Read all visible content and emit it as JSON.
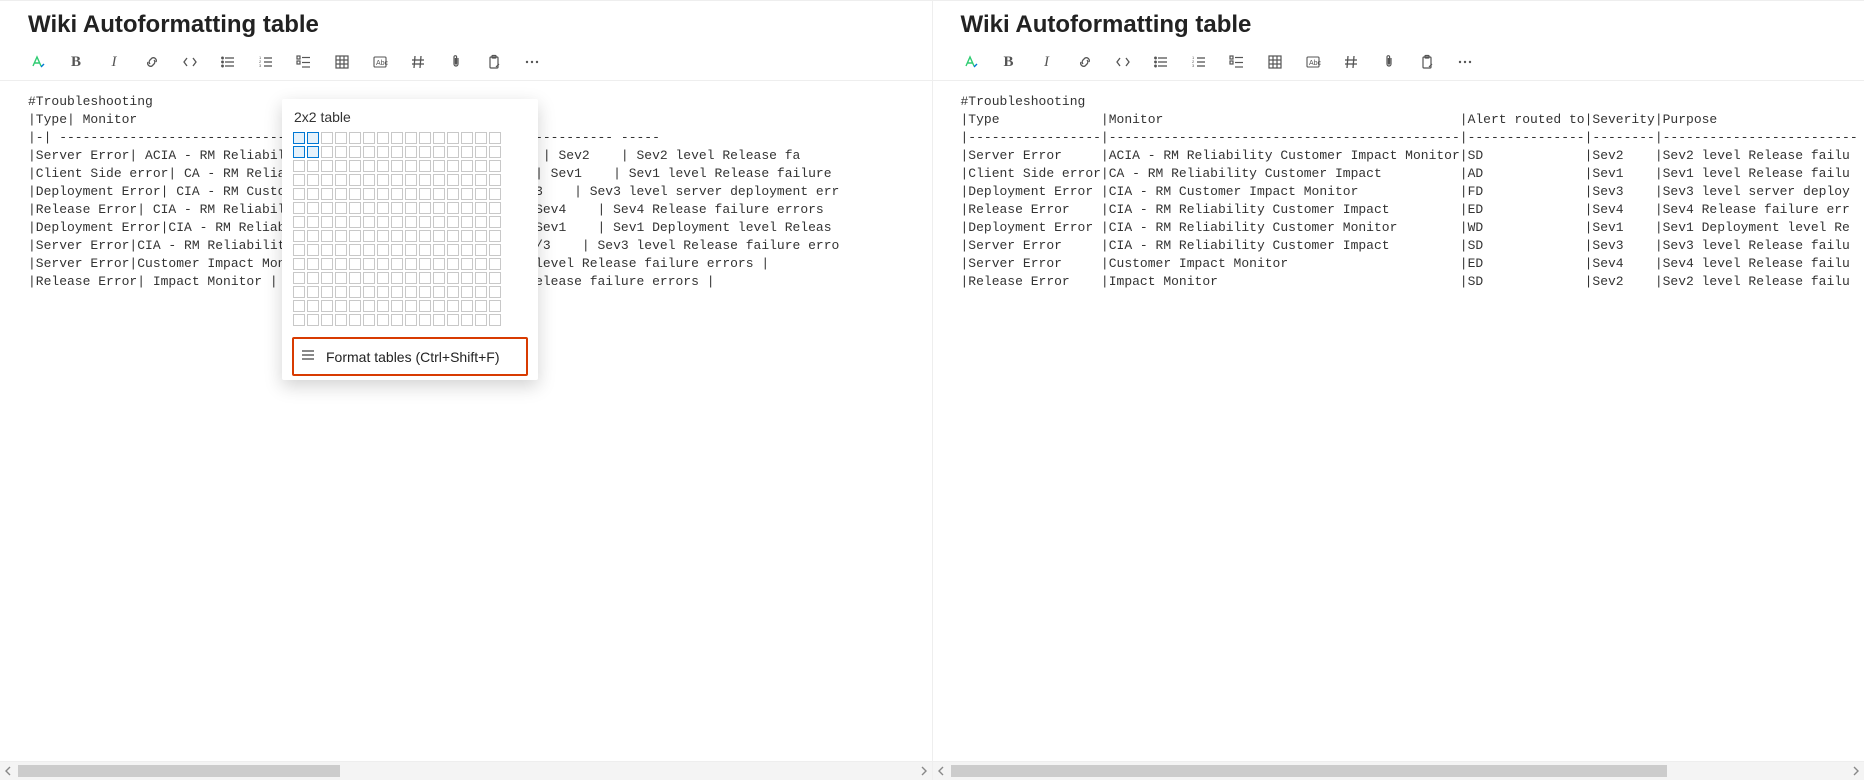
{
  "title": "Wiki Autoformatting table",
  "table_popup": {
    "size_label": "2x2 table",
    "format_label": "Format tables (Ctrl+Shift+F)"
  },
  "left_editor": {
    "lines": [
      "#Troubleshooting",
      "|Type| Monitor",
      "|-| ----------------------------------------------------------------------- -----",
      "|Server Error| ACIA - RM Reliability Cu                           | Sev2    | Sev2 level Release fa",
      "|Client Side error| CA - RM Reliabilit                           | Sev1    | Sev1 level Release failure",
      "|Deployment Error| CIA - RM Customer Im                         /3    | Sev3 level server deployment err",
      "|Release Error| CIA - RM Reliability Cu                          Sev4    | Sev4 Release failure errors",
      "|Deployment Error|CIA - RM Reliability                           Sev1    | Sev1 Deployment level Releas",
      "|Server Error|CIA - RM Reliability Cust                          /3    | Sev3 level Release failure erro",
      "|Server Error|Customer Impact Monitor                            level Release failure errors |",
      "|Release Error| Impact Monitor | SD                              elease failure errors |"
    ]
  },
  "right_editor": {
    "lines": [
      "#Troubleshooting",
      "|Type             |Monitor                                      |Alert routed to|Severity|Purpose",
      "|-----------------|---------------------------------------------|---------------|--------|-------------------------",
      "|Server Error     |ACIA - RM Reliability Customer Impact Monitor|SD             |Sev2    |Sev2 level Release failu",
      "|Client Side error|CA - RM Reliability Customer Impact          |AD             |Sev1    |Sev1 level Release failu",
      "|Deployment Error |CIA - RM Customer Impact Monitor             |FD             |Sev3    |Sev3 level server deploy",
      "|Release Error    |CIA - RM Reliability Customer Impact         |ED             |Sev4    |Sev4 Release failure err",
      "|Deployment Error |CIA - RM Reliability Customer Monitor        |WD             |Sev1    |Sev1 Deployment level Re",
      "|Server Error     |CIA - RM Reliability Customer Impact         |SD             |Sev3    |Sev3 level Release failu",
      "|Server Error     |Customer Impact Monitor                      |ED             |Sev4    |Sev4 level Release failu",
      "|Release Error    |Impact Monitor                               |SD             |Sev2    |Sev2 level Release failu"
    ]
  }
}
